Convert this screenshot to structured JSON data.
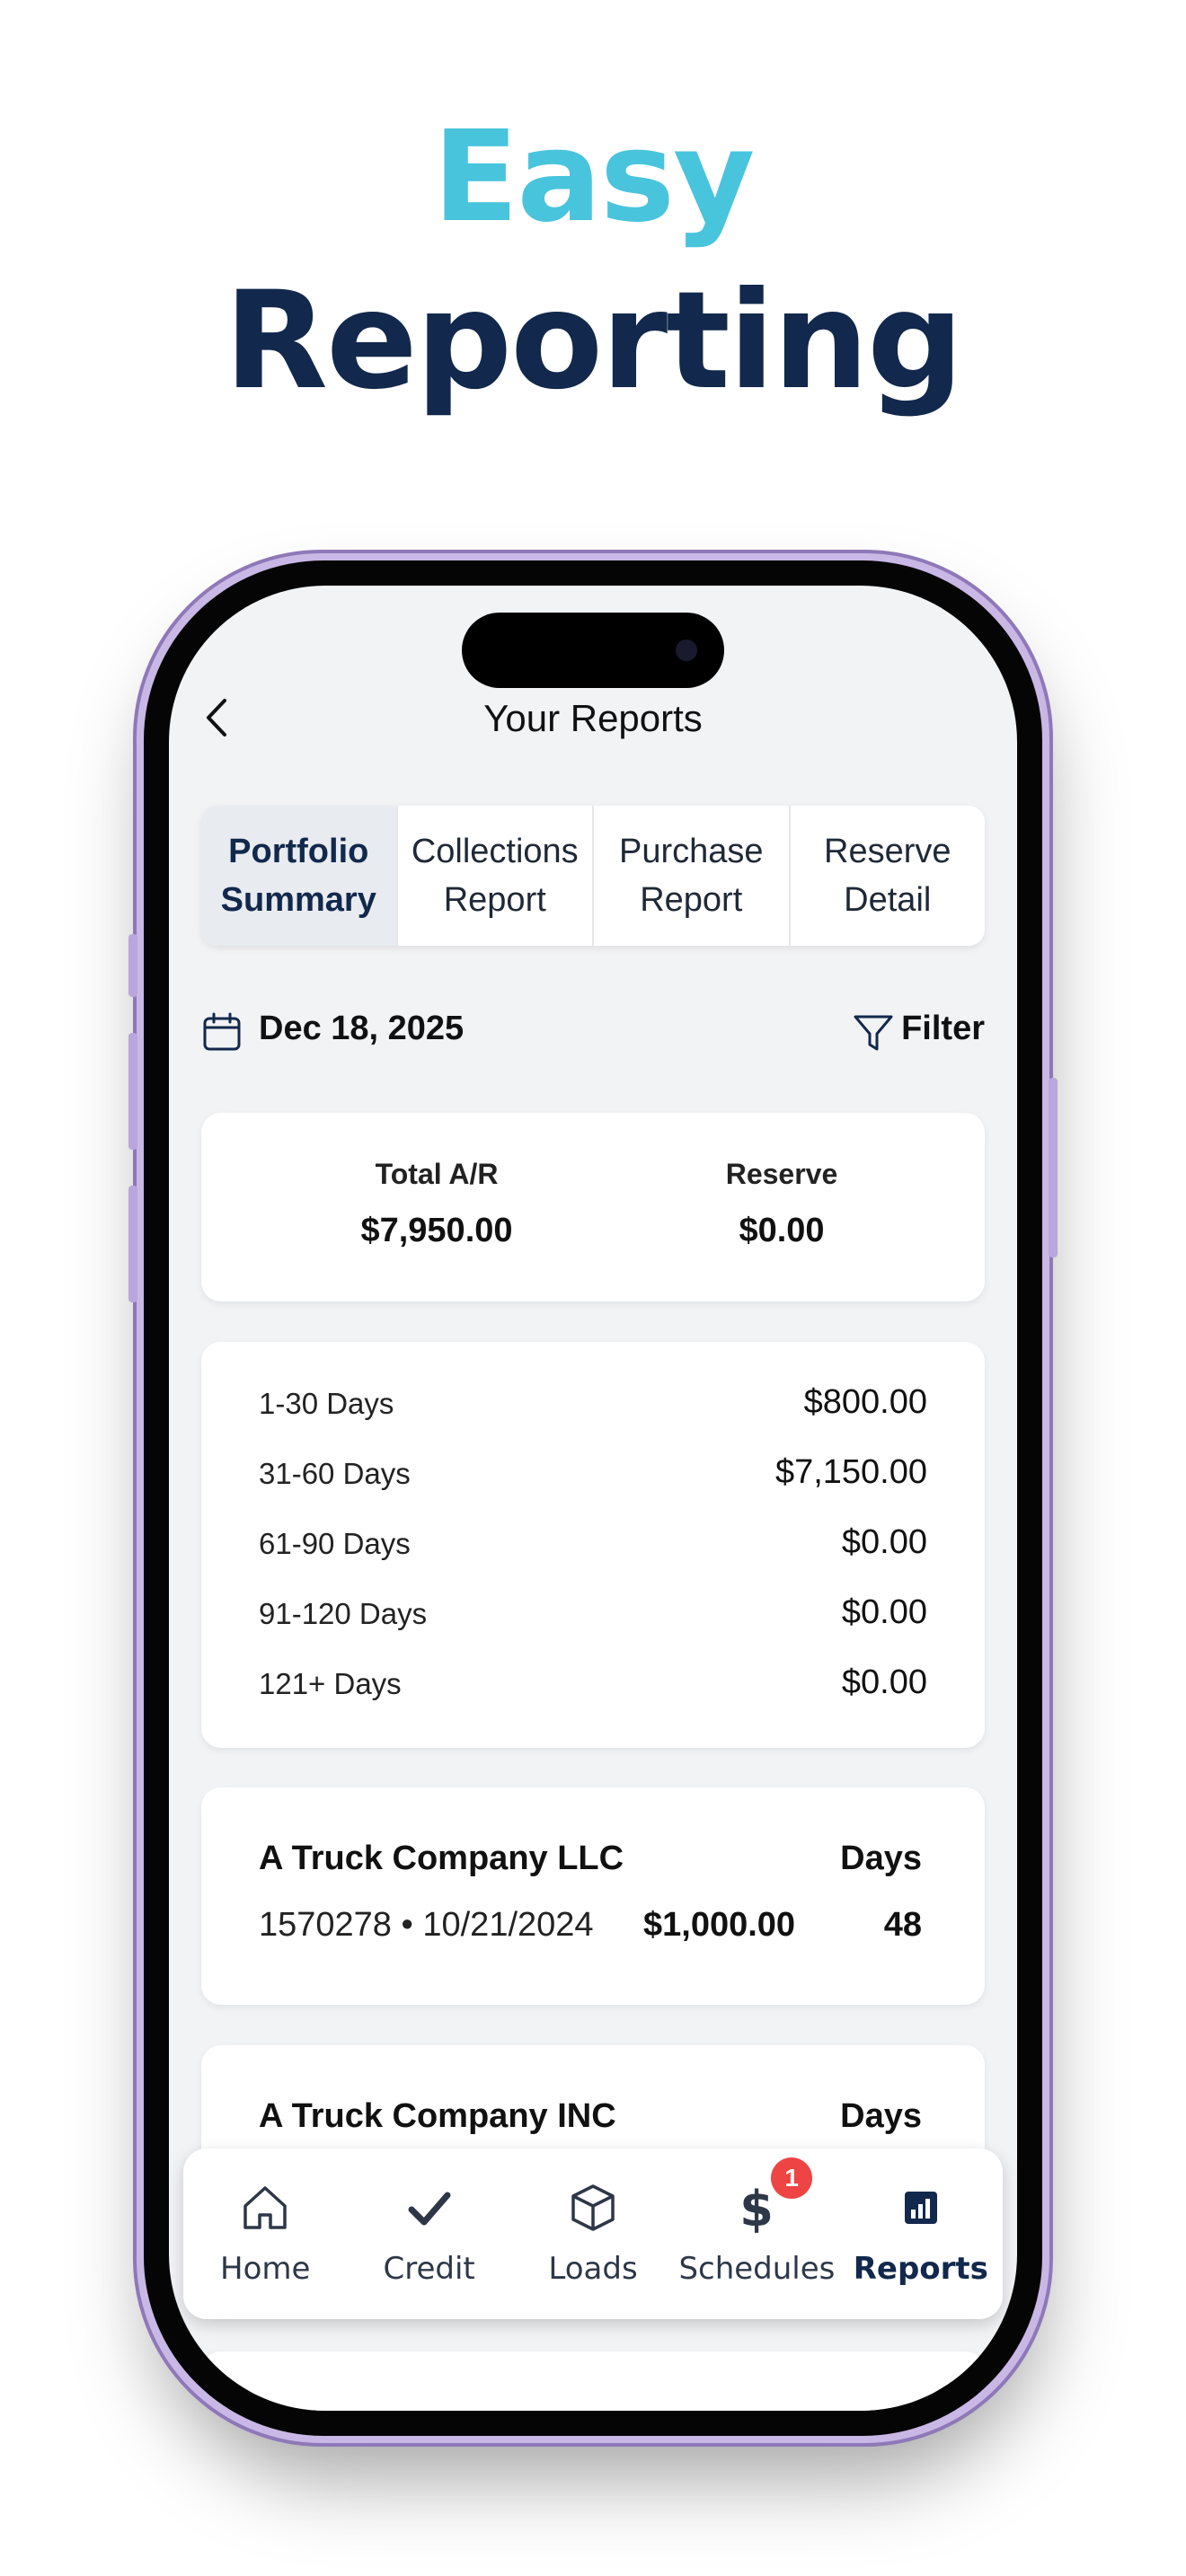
{
  "headline": {
    "line1": "Easy",
    "line2": "Reporting"
  },
  "nav": {
    "title": "Your Reports",
    "back_icon": "chevron-left-icon"
  },
  "tabs": [
    {
      "label": "Portfolio\nSummary",
      "active": true
    },
    {
      "label": "Collections\nReport",
      "active": false
    },
    {
      "label": "Purchase\nReport",
      "active": false
    },
    {
      "label": "Reserve\nDetail",
      "active": false
    }
  ],
  "date_row": {
    "date": "Dec 18, 2025",
    "filter_label": "Filter"
  },
  "summary": {
    "total_ar_label": "Total A/R",
    "total_ar_value": "$7,950.00",
    "reserve_label": "Reserve",
    "reserve_value": "$0.00"
  },
  "aging": [
    {
      "label": "1-30 Days",
      "value": "$800.00"
    },
    {
      "label": "31-60 Days",
      "value": "$7,150.00"
    },
    {
      "label": "61-90 Days",
      "value": "$0.00"
    },
    {
      "label": "91-120 Days",
      "value": "$0.00"
    },
    {
      "label": "121+ Days",
      "value": "$0.00"
    }
  ],
  "invoices": [
    {
      "company": "A Truck Company LLC",
      "days_label": "Days",
      "meta": "1570278 • 10/21/2024",
      "amount": "$1,000.00",
      "days": "48"
    },
    {
      "company": "A Truck Company INC",
      "days_label": "Days"
    }
  ],
  "tabbar": {
    "items": [
      {
        "label": "Home",
        "icon": "home-icon"
      },
      {
        "label": "Credit",
        "icon": "checkmark-icon"
      },
      {
        "label": "Loads",
        "icon": "box-icon"
      },
      {
        "label": "Schedules",
        "icon": "dollar-icon",
        "badge": "1"
      },
      {
        "label": "Reports",
        "icon": "bar-chart-icon",
        "active": true
      }
    ]
  },
  "colors": {
    "accent": "#49c4dd",
    "navy": "#12284c",
    "badge": "#ef4444",
    "screen_bg": "#f2f3f5"
  }
}
